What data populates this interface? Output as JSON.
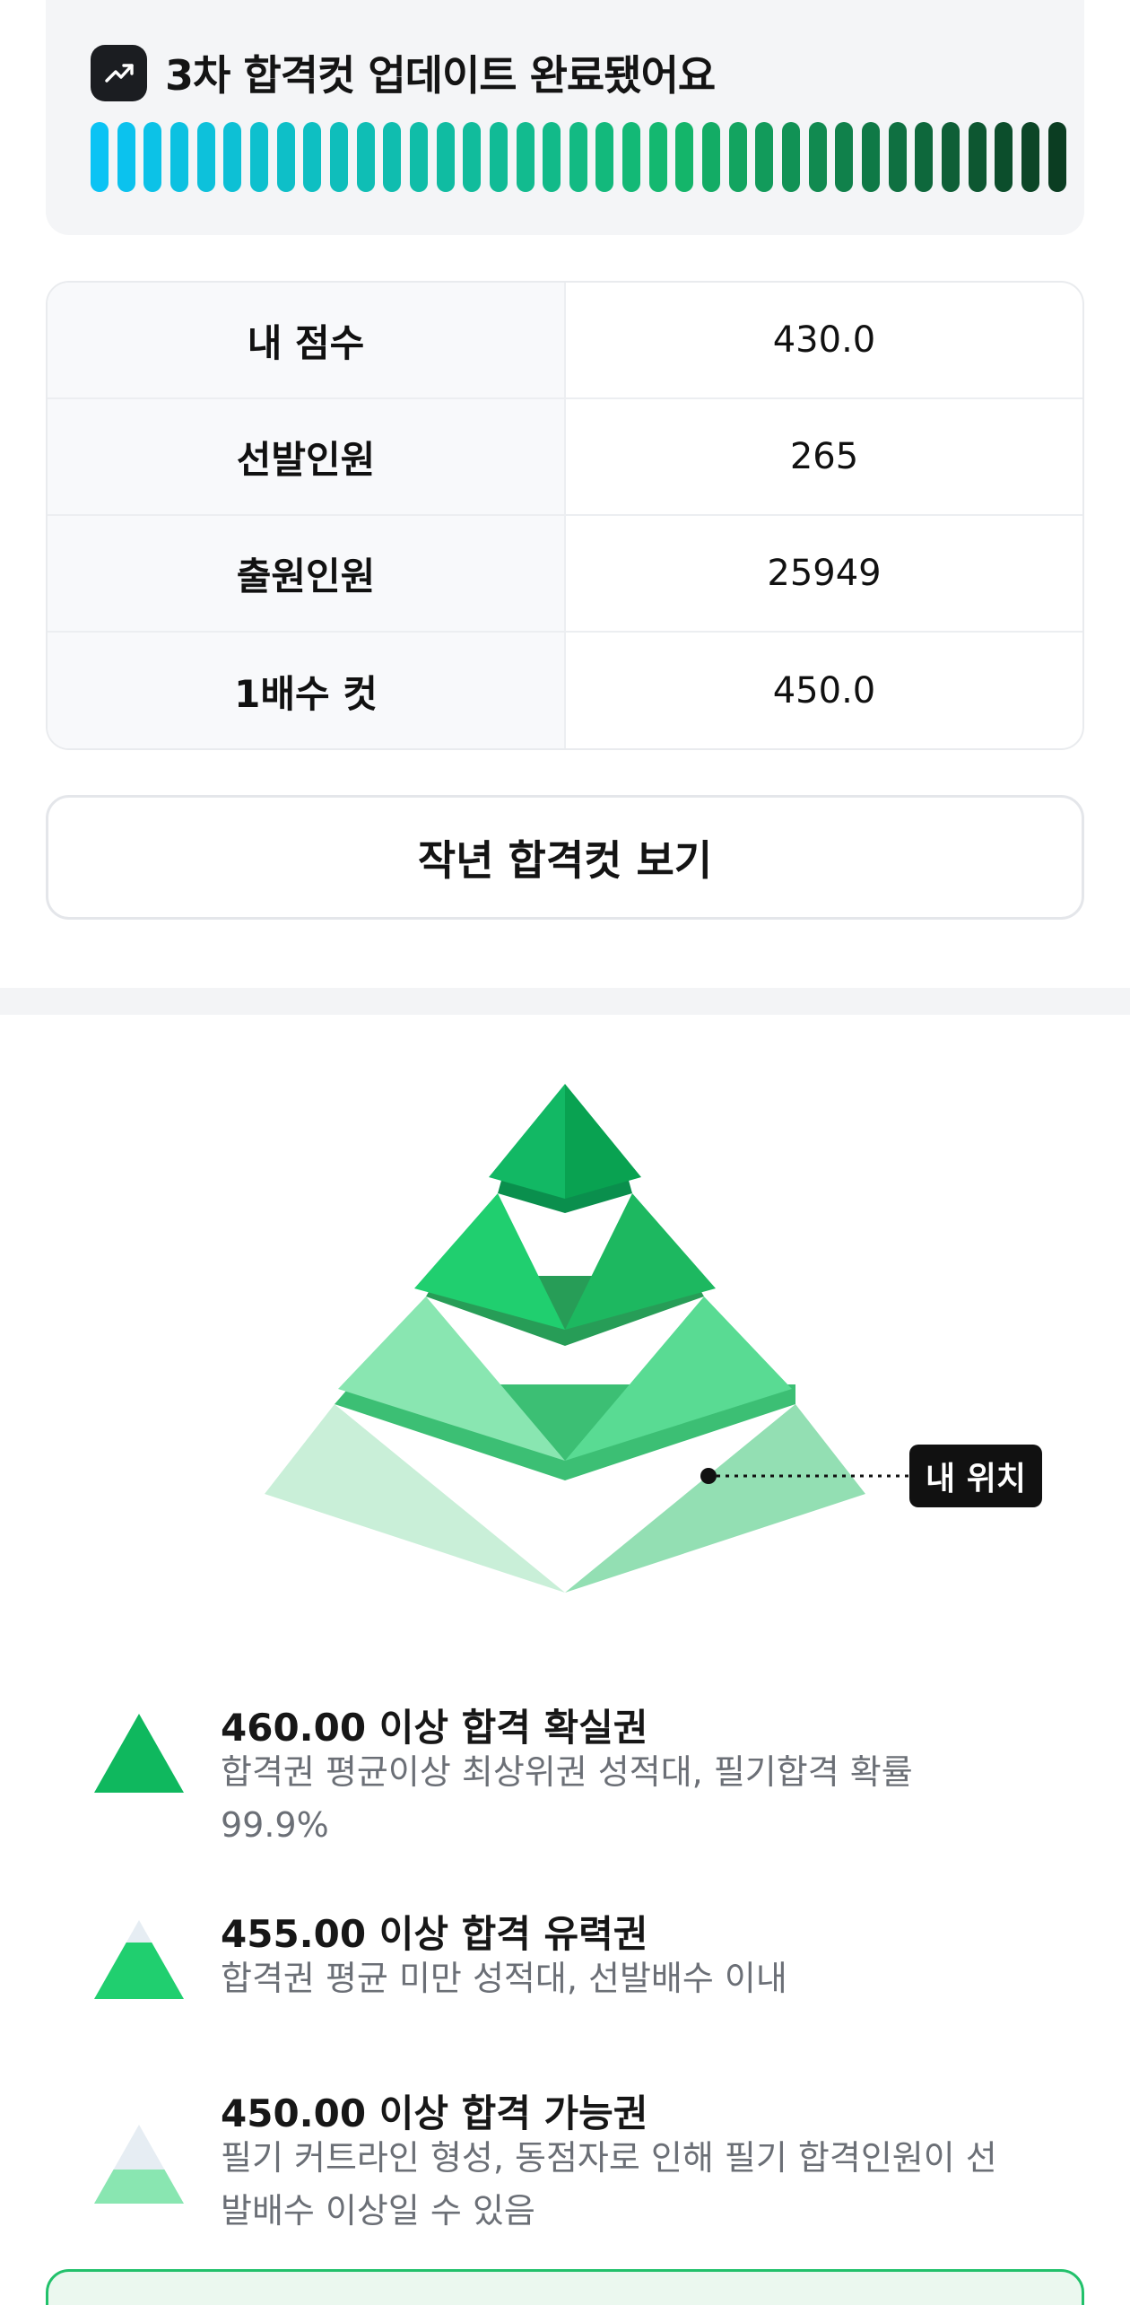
{
  "banner": {
    "icon": "trend-up-icon",
    "title": "3차 합격컷 업데이트 완료됐어요",
    "progress_bar_count": 37
  },
  "info_table": [
    {
      "label": "내 점수",
      "value": "430.0"
    },
    {
      "label": "선발인원",
      "value": "265"
    },
    {
      "label": "출원인원",
      "value": "25949"
    },
    {
      "label": "1배수 컷",
      "value": "450.0"
    }
  ],
  "last_year_button": "작년 합격컷 보기",
  "pyramid": {
    "my_position_label": "내 위치"
  },
  "legend": [
    {
      "title": "460.00 이상 합격 확실권",
      "description": "합격권 평균이상 최상위권 성적대, 필기합격 확률 99.9%"
    },
    {
      "title": "455.00 이상 합격 유력권",
      "description": "합격권 평균 미만 성적대, 선발배수 이내"
    },
    {
      "title": "450.00 이상 합격 가능권",
      "description": "필기 커트라인 형성, 동점자로 인해 필기 합격인원이 선발배수 이상일 수 있음"
    }
  ],
  "colors": {
    "gradient_start": "#0bc3f4",
    "gradient_mid": "#14b86c",
    "gradient_end": "#0b3d22",
    "tier1": "#0fb85e",
    "tier2": "#20cf6f",
    "tier3": "#89e6b1",
    "tier4": "#c9efd8"
  }
}
